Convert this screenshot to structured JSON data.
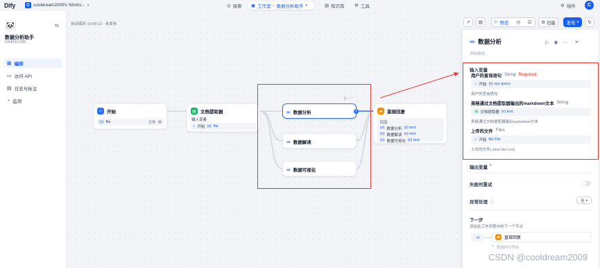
{
  "topbar": {
    "logo": "Dify",
    "workspace_initial": "C",
    "workspace_name": "cooldream2009's Works...",
    "nav_explore": "探索",
    "nav_studio": "工作室",
    "nav_app": "数据分析助手",
    "nav_knowledge": "知识库",
    "nav_tools": "工具",
    "plugins": "插件",
    "avatar_initial": "C"
  },
  "sidebar": {
    "app_name": "数据分析助手",
    "app_type": "CHATFLOW",
    "items": [
      {
        "label": "编排",
        "icon": "grid-icon"
      },
      {
        "label": "访问 API",
        "icon": "api-icon"
      },
      {
        "label": "日志与标注",
        "icon": "log-icon"
      },
      {
        "label": "监测",
        "icon": "monitor-icon"
      }
    ]
  },
  "canvas": {
    "autosave": "自动保存 10:09:12 · 未发布",
    "start_node": {
      "title": "开始",
      "var_prefix": "{x}",
      "var_name": "file",
      "var_type": "文件"
    },
    "extractor_node": {
      "title": "文档提取器",
      "input_label": "输入变量",
      "source_node": "开始",
      "var_prefix": "{x}",
      "var_name": "file"
    },
    "iter_nodes": [
      {
        "title": "数据分析"
      },
      {
        "title": "数据解读"
      },
      {
        "title": "数据可视化"
      }
    ],
    "answer_node": {
      "title": "直接回复",
      "label": "回复",
      "lines": [
        {
          "node": "数据分析",
          "var": "{x} text"
        },
        {
          "node": "数据解读",
          "var": "{x} text"
        },
        {
          "node": "数据可视化",
          "var": "{x} text"
        }
      ]
    }
  },
  "toolbar": {
    "preview": "预览",
    "features": "功能",
    "publish": "发布"
  },
  "panel": {
    "title": "数据分析",
    "desc_placeholder": "添加描述...",
    "input_section": "输入变量",
    "fields": [
      {
        "label": "用户的查询语句",
        "type": "String",
        "required": "Required",
        "node": "开始",
        "var": "{x} sys.query",
        "desc": "用户的查询语句"
      },
      {
        "label": "美格通过文档提取器输出的markdown文本",
        "type": "String",
        "node": "文档提取器",
        "var": "{x} text",
        "desc": "表格通过文档提取器输出markdown文本"
      },
      {
        "label": "上传的文件",
        "type": "Files",
        "node": "开始",
        "var": "file File",
        "desc": "上传的文件(.xlsx/.xls/.csv)"
      }
    ],
    "output_section": "输出变量",
    "retry_label": "失败时重试",
    "error_label": "异常处理",
    "error_value": "无",
    "next_section": "下一步",
    "next_desc": "添加此工作流程中的下一个节点",
    "next_node": "直接回复",
    "add_parallel": "添加并行节点"
  },
  "watermark": "CSDN @cooldream2009",
  "colors": {
    "accent": "#155eef",
    "highlight": "#e53935",
    "answer_node": "#f79009",
    "extractor_node": "#16b364"
  }
}
